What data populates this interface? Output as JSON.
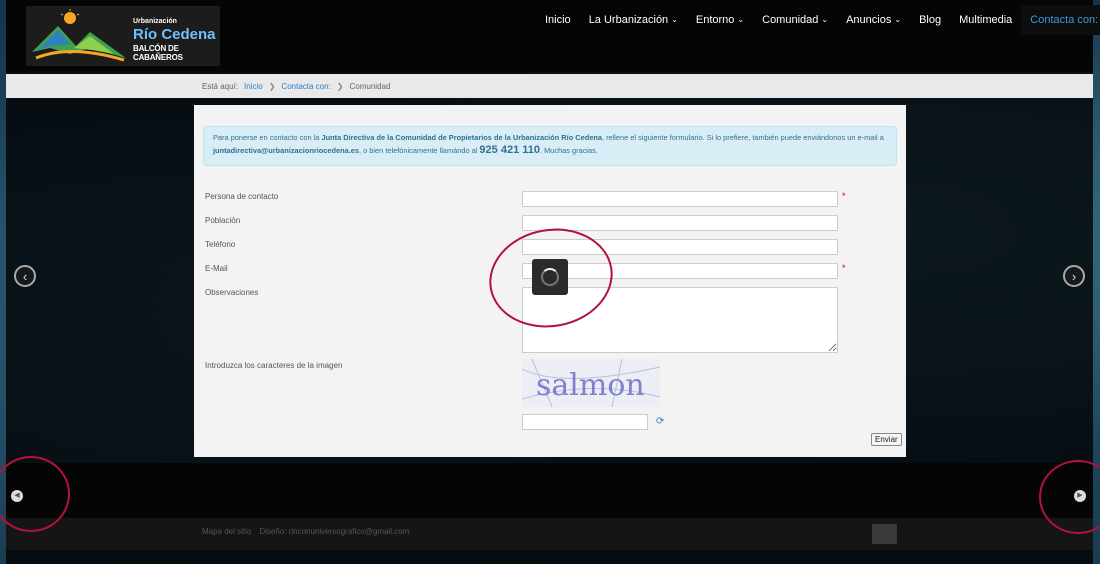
{
  "logo": {
    "line1": "Urbanización",
    "line2": "Río Cedena",
    "line3": "BALCÓN DE CABAÑEROS"
  },
  "nav": {
    "items": [
      {
        "label": "Inicio",
        "has_menu": false
      },
      {
        "label": "La Urbanización",
        "has_menu": true
      },
      {
        "label": "Entorno",
        "has_menu": true
      },
      {
        "label": "Comunidad",
        "has_menu": true
      },
      {
        "label": "Anuncios",
        "has_menu": true
      },
      {
        "label": "Blog",
        "has_menu": false
      },
      {
        "label": "Multimedia",
        "has_menu": false
      },
      {
        "label": "Contacta con:",
        "has_menu": true,
        "active": true
      }
    ]
  },
  "breadcrumb": {
    "prefix": "Está aquí:",
    "home": "Inicio",
    "level1": "Contacta con:",
    "current": "Comunidad"
  },
  "info": {
    "t1": "Para ponerse en contacto con la ",
    "b1": "Junta Directiva de la Comunidad de Propietarios de la Urbanización Río Cedena",
    "t2": ", rellene el siguiente formulario. Si lo prefiere, también puede enviándonos un e-mail a ",
    "email": "juntadirectiva@urbanizacionriocedena.es",
    "t3": ", o bien telefónicamente llamándo al ",
    "phone": "925 421 110",
    "t4": ". Muchas gracias."
  },
  "form": {
    "contact_label": "Persona de contacto",
    "town_label": "Población",
    "phone_label": "Teléfono",
    "email_label": "E-Mail",
    "notes_label": "Observaciones",
    "captcha_label": "Introduzca los caracteres de la imagen",
    "captcha_text": "salmon",
    "required_mark": "*",
    "send_label": "Enviar"
  },
  "footer": {
    "sitemap": "Mapa del sitio",
    "design": "Diseño: rinconuniversografico@gmail.com"
  },
  "colors": {
    "accent": "#3a9bdc",
    "ring": "#b4123a",
    "info_bg": "#d9edf7",
    "info_text": "#31708f"
  }
}
